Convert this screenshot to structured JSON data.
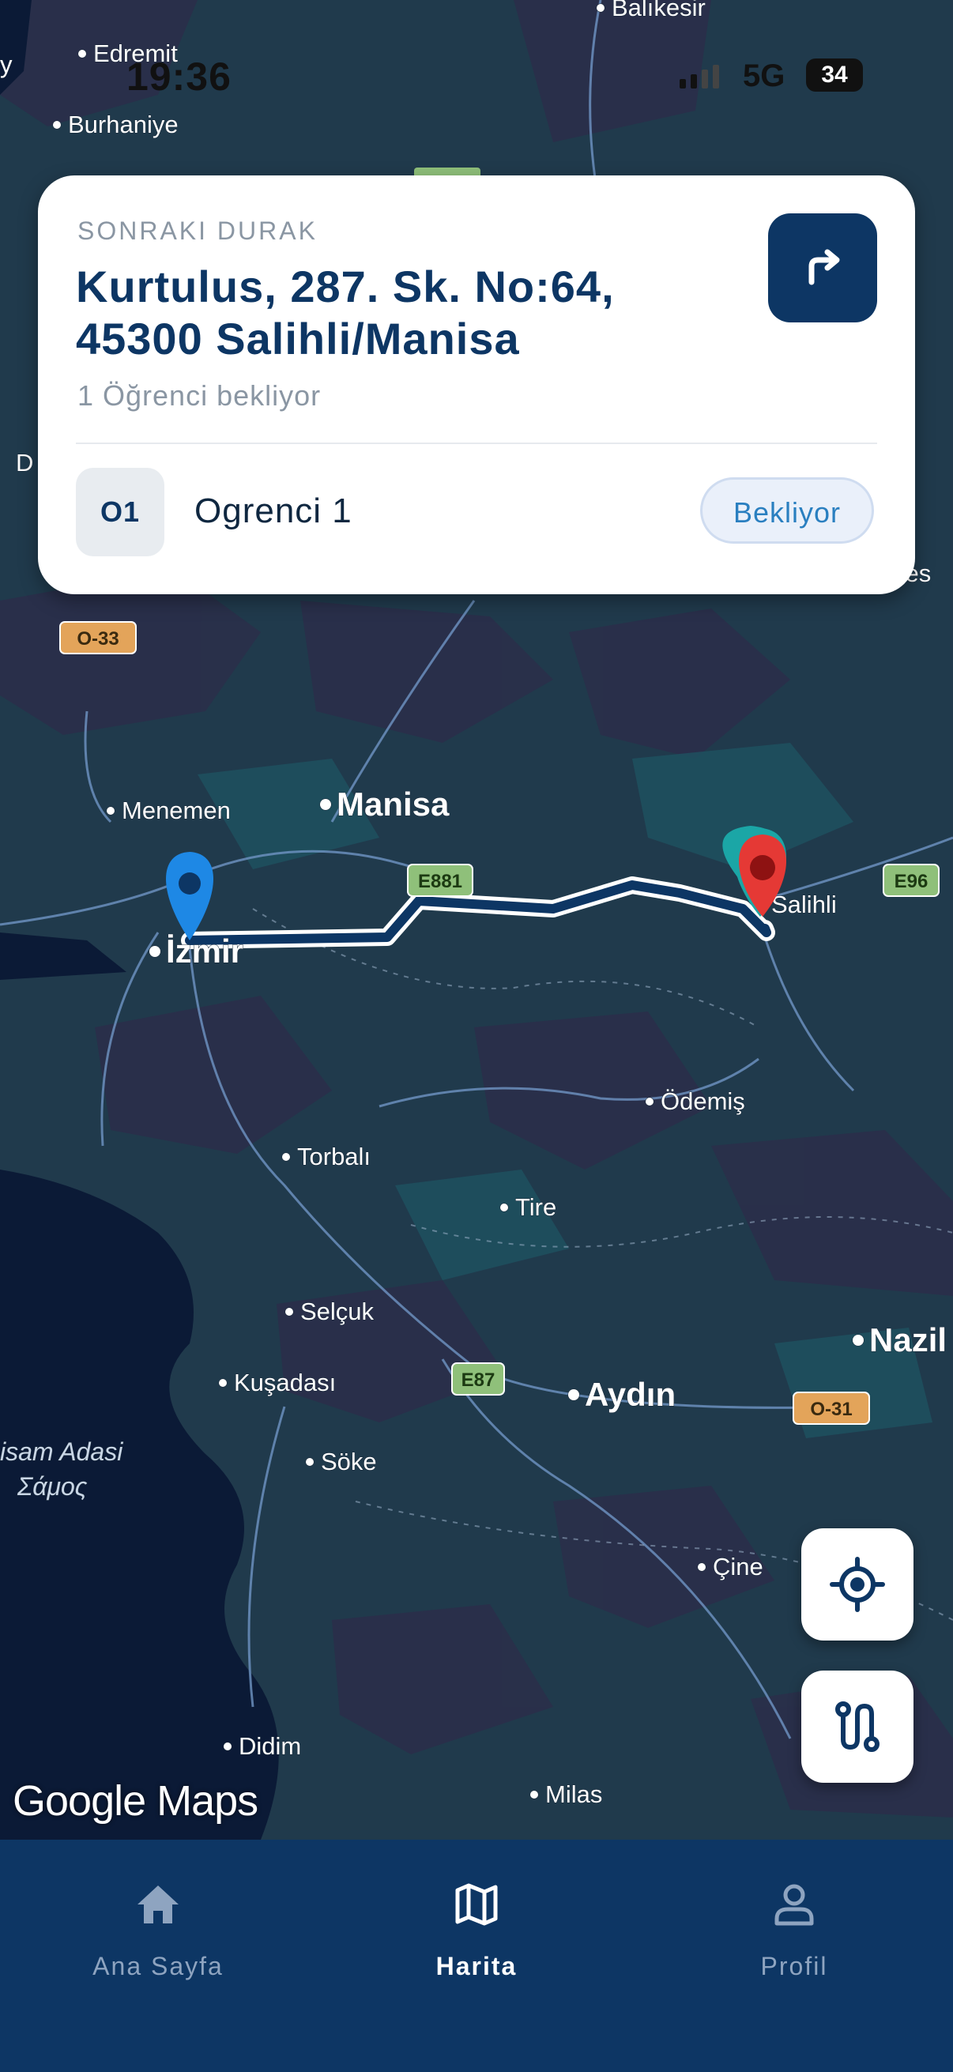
{
  "status_bar": {
    "time": "19:36",
    "network": "5G",
    "battery": "34"
  },
  "map": {
    "watermark": "Google Maps",
    "places": [
      {
        "name": "Balıkesir",
        "major": false
      },
      {
        "name": "Edremit",
        "major": false
      },
      {
        "name": "Burhaniye",
        "major": false
      },
      {
        "name": "Menemen",
        "major": false
      },
      {
        "name": "Manisa",
        "major": true
      },
      {
        "name": "İzmir",
        "major": true
      },
      {
        "name": "Salihli",
        "major": false
      },
      {
        "name": "Ödemiş",
        "major": false
      },
      {
        "name": "Torbalı",
        "major": false
      },
      {
        "name": "Tire",
        "major": false
      },
      {
        "name": "Selçuk",
        "major": false
      },
      {
        "name": "Kuşadası",
        "major": false
      },
      {
        "name": "Aydın",
        "major": true
      },
      {
        "name": "Nazil",
        "major": true
      },
      {
        "name": "Söke",
        "major": false
      },
      {
        "name": "Çine",
        "major": false
      },
      {
        "name": "Didim",
        "major": false
      },
      {
        "name": "Milas",
        "major": false
      }
    ],
    "partial_labels": [
      "y",
      "D",
      "ses"
    ],
    "island_label_1": "isam Adasi",
    "island_label_2": "Σάμος",
    "roads": [
      "O-33",
      "E881",
      "E96",
      "E87",
      "O-31"
    ]
  },
  "next_stop": {
    "kicker": "SONRAKI DURAK",
    "address_line1": "Kurtulus, 287. Sk. No:64,",
    "address_line2": "45300 Salihli/Manisa",
    "waiting_text": "1 Öğrenci bekliyor",
    "student": {
      "code": "O1",
      "name": "Ogrenci 1",
      "status": "Bekliyor"
    }
  },
  "tabs": [
    {
      "label": "Ana Sayfa",
      "icon": "home-icon",
      "active": false
    },
    {
      "label": "Harita",
      "icon": "map-icon",
      "active": true
    },
    {
      "label": "Profil",
      "icon": "user-icon",
      "active": false
    }
  ],
  "colors": {
    "primary": "#0d3664",
    "badge_text": "#2a7fc0",
    "pin_blue": "#1e88e5",
    "pin_red": "#e53935",
    "pin_teal": "#1ba6a6"
  }
}
